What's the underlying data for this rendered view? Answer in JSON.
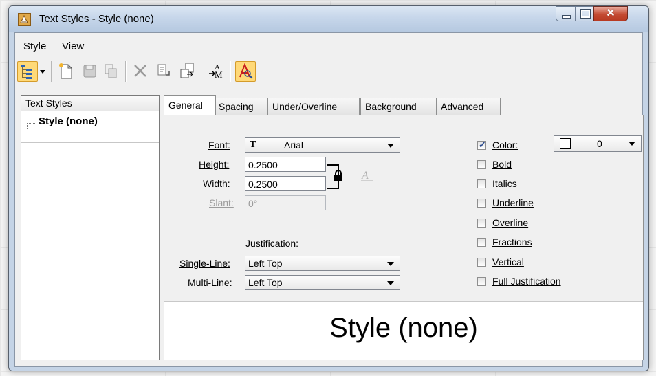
{
  "window": {
    "title": "Text Styles - Style (none)"
  },
  "menu": {
    "items": [
      "Style",
      "View"
    ]
  },
  "toolbar": {
    "icons": [
      "tree-view-icon",
      "dropdown-arrow-icon",
      "new-style-icon",
      "save-style-icon",
      "copy-style-icon",
      "delete-style-icon",
      "import-icon",
      "export-icon",
      "update-from-style-icon",
      "style-preview-icon"
    ]
  },
  "tree": {
    "header": "Text Styles",
    "items": [
      "Style (none)"
    ]
  },
  "tabs": [
    "General",
    "Spacing",
    "Under/Overline",
    "Background",
    "Advanced"
  ],
  "general": {
    "font_label": "Font:",
    "font_value": "Arial",
    "height_label": "Height:",
    "height_value": "0.2500",
    "width_label": "Width:",
    "width_value": "0.2500",
    "slant_label": "Slant:",
    "slant_value": "0°",
    "justification_label": "Justification:",
    "single_line_label": "Single-Line:",
    "single_line_value": "Left Top",
    "multi_line_label": "Multi-Line:",
    "multi_line_value": "Left Top",
    "color_label": "Color:",
    "color_value": "0",
    "checkboxes": [
      {
        "label": "Color:",
        "checked": true
      },
      {
        "label": "Bold",
        "checked": false
      },
      {
        "label": "Italics",
        "checked": false
      },
      {
        "label": "Underline",
        "checked": false
      },
      {
        "label": "Overline",
        "checked": false
      },
      {
        "label": "Fractions",
        "checked": false
      },
      {
        "label": "Vertical",
        "checked": false
      },
      {
        "label": "Full Justification",
        "checked": false
      }
    ]
  },
  "preview": {
    "text": "Style (none)"
  },
  "colors": {
    "titlebar": "#c6d6ea",
    "close_button": "#c44b33",
    "active_toolbar": "#ffd978"
  }
}
